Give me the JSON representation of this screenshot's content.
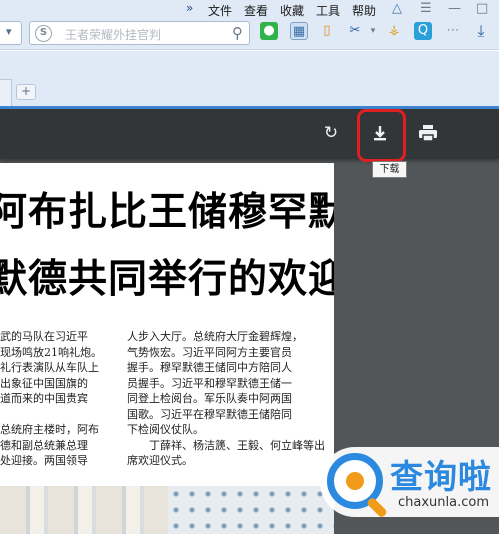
{
  "menubar": {
    "chevron": "»",
    "items": [
      "文件",
      "查看",
      "收藏",
      "工具",
      "帮助"
    ]
  },
  "toolbar": {
    "search_placeholder": "王者荣耀外挂官判"
  },
  "viewer": {
    "download_tooltip": "下载"
  },
  "document": {
    "headline_lines": [
      "阿布扎比王储穆罕默德",
      "默德共同举行的欢迎仪式"
    ],
    "left_column": [
      "武的马队在习近平",
      "现场鸣放21响礼炮。",
      "礼行表演队从车队上",
      "出象征中国国旗的",
      "道而来的中国贵宾",
      "",
      "总统府主楼时，阿布",
      "德和副总统兼总理",
      "处迎接。两国领导"
    ],
    "right_column": [
      "人步入大厅。总统府大厅金碧辉煌，",
      "气势恢宏。习近平同阿方主要官员",
      "握手。穆罕默德王储同中方陪同人",
      "员握手。习近平和穆罕默德王储一",
      "同登上检阅台。军乐队奏中阿两国",
      "国歌。习近平在穆罕默德王储陪同",
      "下检阅仪仗队。",
      "　　丁薛祥、杨洁篪、王毅、何立峰等出",
      "席欢迎仪式。"
    ]
  },
  "watermark": {
    "title": "查询啦",
    "url": "chaxunla.com"
  },
  "colors": {
    "chrome_bg": "#dfeaf6",
    "tab_accent": "#3e86d4",
    "viewer_toolbar": "#323639",
    "viewer_bg": "#525659",
    "highlight": "#e02020",
    "watermark_blue": "#2b8ae0",
    "watermark_orange": "#f29a1a"
  }
}
